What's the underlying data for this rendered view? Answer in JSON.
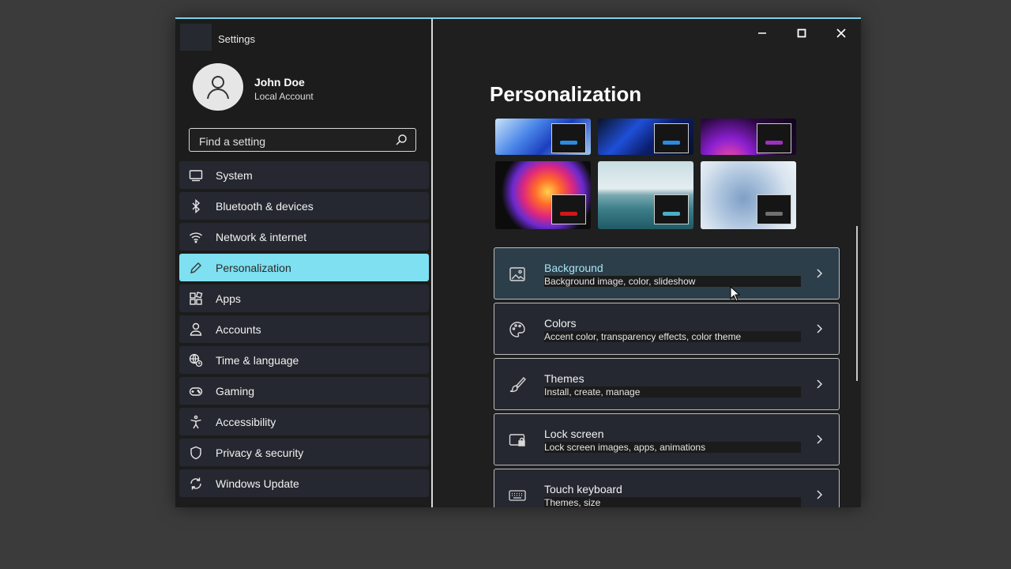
{
  "window": {
    "title": "Settings"
  },
  "profile": {
    "name": "John Doe",
    "account_type": "Local Account"
  },
  "search": {
    "placeholder": "Find a setting"
  },
  "nav": {
    "items": [
      {
        "label": "System",
        "icon": "monitor-icon"
      },
      {
        "label": "Bluetooth & devices",
        "icon": "bluetooth-icon"
      },
      {
        "label": "Network & internet",
        "icon": "wifi-icon"
      },
      {
        "label": "Personalization",
        "icon": "pen-icon",
        "active": true
      },
      {
        "label": "Apps",
        "icon": "apps-icon"
      },
      {
        "label": "Accounts",
        "icon": "person-icon"
      },
      {
        "label": "Time & language",
        "icon": "globe-clock-icon"
      },
      {
        "label": "Gaming",
        "icon": "gamepad-icon"
      },
      {
        "label": "Accessibility",
        "icon": "accessibility-icon"
      },
      {
        "label": "Privacy & security",
        "icon": "shield-icon"
      },
      {
        "label": "Windows Update",
        "icon": "sync-icon"
      }
    ]
  },
  "main": {
    "page_title": "Personalization",
    "themes": [
      {
        "name": "windows-bloom-dark",
        "accent": "#2a8ce0"
      },
      {
        "name": "windows-bloom-dark-2",
        "accent": "#2a8ce0"
      },
      {
        "name": "glow",
        "accent": "#a030c0"
      },
      {
        "name": "captured-motion",
        "accent": "#d01818"
      },
      {
        "name": "sunrise-lake",
        "accent": "#4ab0c8"
      },
      {
        "name": "flow",
        "accent": "#707070"
      }
    ],
    "cards": [
      {
        "title": "Background",
        "subtitle": "Background image, color, slideshow",
        "icon": "image-icon",
        "active": true
      },
      {
        "title": "Colors",
        "subtitle": "Accent color, transparency effects, color theme",
        "icon": "palette-icon"
      },
      {
        "title": "Themes",
        "subtitle": "Install, create, manage",
        "icon": "brush-icon"
      },
      {
        "title": "Lock screen",
        "subtitle": "Lock screen images, apps, animations",
        "icon": "lock-screen-icon"
      },
      {
        "title": "Touch keyboard",
        "subtitle": "Themes, size",
        "icon": "keyboard-icon"
      }
    ]
  },
  "colors": {
    "accent": "#7ee0f0",
    "window_border": "#7fd0e6",
    "sidebar_bg": "#1c1c1c",
    "card_bg": "#252830"
  }
}
